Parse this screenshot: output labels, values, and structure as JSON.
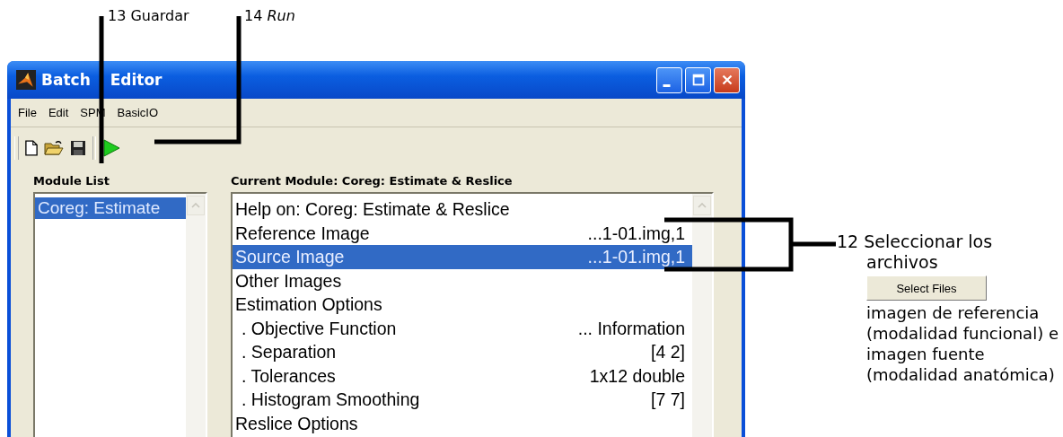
{
  "window": {
    "title": "Batch Editor"
  },
  "menu": [
    "File",
    "Edit",
    "SPM",
    "BasicIO"
  ],
  "toolbar": [
    {
      "kind": "new"
    },
    {
      "kind": "open"
    },
    {
      "kind": "save"
    },
    {
      "kind": "run"
    }
  ],
  "module_list": {
    "title": "Module List",
    "items": [
      {
        "label": "Coreg: Estimate",
        "selected": true
      }
    ]
  },
  "current_module": {
    "title": "Current Module: Coreg: Estimate & Reslice",
    "items": [
      {
        "label": "Help on: Coreg: Estimate & Reslice",
        "selected": false
      },
      {
        "label": "Reference Image",
        "value": "...1-01.img,1",
        "selected": false
      },
      {
        "label": "Source Image",
        "value": "...1-01.img,1",
        "selected": true
      },
      {
        "label": "Other Images",
        "selected": false
      },
      {
        "label": "Estimation Options",
        "selected": false,
        "children": [
          {
            "label": ". Objective Function",
            "value": "... Information",
            "selected": false
          },
          {
            "label": ". Separation",
            "value": "[4 2]",
            "selected": false
          },
          {
            "label": ". Tolerances",
            "value": "1x12 double",
            "selected": false
          },
          {
            "label": ". Histogram Smoothing",
            "value": "[7 7]",
            "selected": false
          }
        ]
      },
      {
        "label": "Reslice Options",
        "selected": false
      }
    ]
  },
  "annotations": [
    {
      "kind": "save",
      "text": "13 Guardar"
    },
    {
      "kind": "run",
      "text": "14 *Run*"
    },
    {
      "kind": "files",
      "text": "12 Seleccionar los archivos",
      "button": "Select Files",
      "note": "imagen de referencia (modalidad funcional) e imagen fuente (modalidad anatómica)"
    }
  ]
}
